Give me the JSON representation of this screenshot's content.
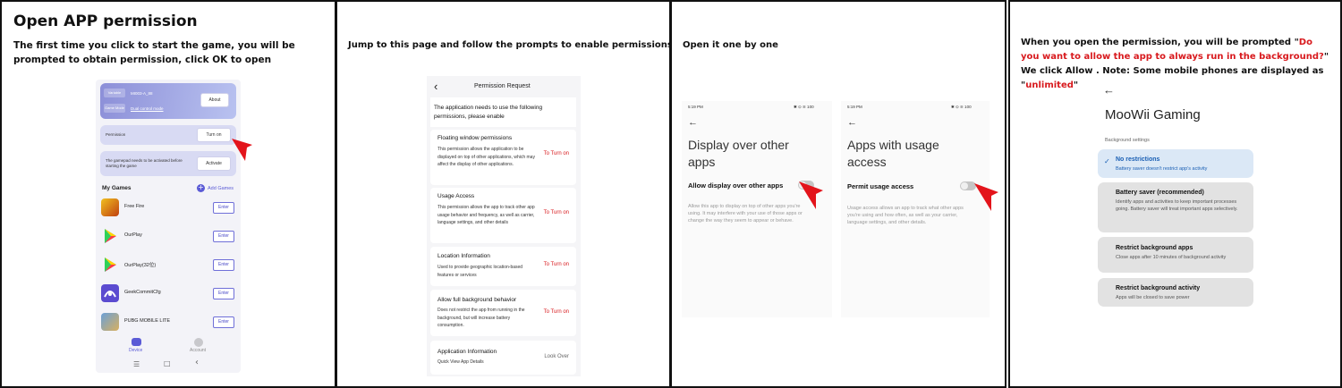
{
  "panel1": {
    "title": "Open APP permission",
    "subtitle": "The first time you click to start the game, you will be prompted to obtain permission, click OK to open",
    "phone": {
      "header_line1_label": "Variable",
      "header_line1_value": "MI003-A_88",
      "header_line2_label": "Game Mode",
      "header_line2_value": "Dual control mode",
      "about_button": "About",
      "permission_label": "Permission",
      "turn_on_button": "Turn on",
      "gamepad_note": "The gamepad needs to be activated before starting the game",
      "activate_button": "Activate",
      "my_games_label": "My Games",
      "add_games_label": "Add Games",
      "games": [
        {
          "name": "Free Fire",
          "action": "Enter"
        },
        {
          "name": "OurPlay",
          "action": "Enter"
        },
        {
          "name": "OurPlay(32位)",
          "action": "Enter"
        },
        {
          "name": "GeekCommitCfg",
          "action": "Enter"
        },
        {
          "name": "PUBG MOBILE LITE",
          "action": "Enter"
        }
      ],
      "nav_device": "Device",
      "nav_account": "Account",
      "sys_nav": [
        "☰",
        "□",
        "‹"
      ]
    }
  },
  "panel2": {
    "title": "Jump to this page and follow the prompts to enable permissions",
    "phone": {
      "back_glyph": "‹",
      "page_title": "Permission Request",
      "intro": "The application needs to use the following permissions, please enable",
      "permissions": [
        {
          "title": "Floating window permissions",
          "desc": "This permission allows the application to be displayed on top of other applications, which may affect the display of other applications.",
          "action": "To Turn on"
        },
        {
          "title": "Usage Access",
          "desc": "This permission allows the app to track other app usage behavior and frequency, as well as carrier, language settings, and other details",
          "action": "To Turn on"
        },
        {
          "title": "Location Information",
          "desc": "Used to provide geographic location-based features or services",
          "action": "To Turn on"
        },
        {
          "title": "Allow full background behavior",
          "desc": "Does not restrict the app from running in the background, but will increase battery consumption.",
          "action": "To Turn on"
        },
        {
          "title": "Application Information",
          "desc": "Quick View App Details",
          "action": "Look Over"
        }
      ]
    }
  },
  "panel3": {
    "title": "Open it one by one",
    "screens": [
      {
        "time": "5:19 PM",
        "status_icons": "✱ ⊙ ≋ 100",
        "back_glyph": "←",
        "heading": "Display over other apps",
        "toggle_label": "Allow display over other apps",
        "desc": "Allow this app to display on top of other apps you're using. It may interfere with your use of those apps or change the way they seem to appear or behave."
      },
      {
        "time": "5:19 PM",
        "status_icons": "✱ ⊙ ≋ 100",
        "back_glyph": "←",
        "heading": "Apps with usage access",
        "toggle_label": "Permit usage access",
        "desc": "Usage access allows an app to track what other apps you're using and how often, as well as your carrier, language settings, and other details."
      }
    ]
  },
  "panel4": {
    "text_part1": "When you open the permission, you will be prompted \"",
    "text_red1": "Do you want to allow the app to always run in the background?",
    "text_part2": "\" We click Allow . Note: Some mobile phones are displayed as \"",
    "text_red2": "unlimited",
    "text_part3": "\"",
    "phone": {
      "back_glyph": "←",
      "app_name": "MooWii Gaming",
      "section_label": "Background settings",
      "options": [
        {
          "title": "No restrictions",
          "desc": "Battery saver doesn't restrict app's activity",
          "selected": true
        },
        {
          "title": "Battery saver (recommended)",
          "desc": "Identify apps and activities to keep important processes going. Battery saver will treat important apps selectively.",
          "selected": false
        },
        {
          "title": "Restrict background apps",
          "desc": "Close apps after 10 minutes of background activity",
          "selected": false
        },
        {
          "title": "Restrict background activity",
          "desc": "Apps will be closed to save power",
          "selected": false
        }
      ]
    }
  },
  "colors": {
    "pointer_red": "#e3141b",
    "action_red": "#d8191d",
    "accent_purple": "#5b5bd6",
    "selected_blue": "#dbe8f6",
    "selected_text_blue": "#1a5fb4"
  }
}
